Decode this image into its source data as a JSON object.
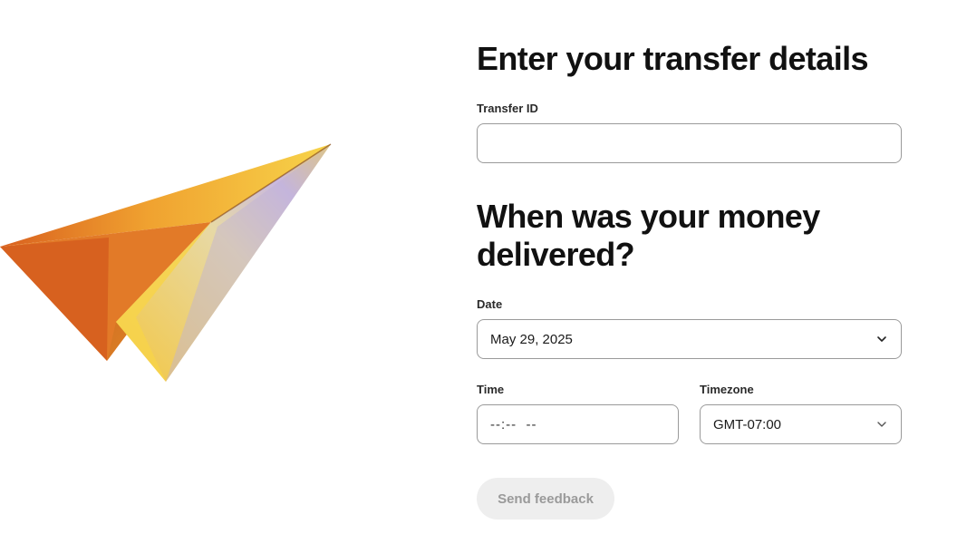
{
  "form": {
    "title": "Enter your transfer details",
    "transfer_id_label": "Transfer ID",
    "transfer_id_value": "",
    "delivery_heading": "When was your money delivered?",
    "date_label": "Date",
    "date_value": "May 29, 2025",
    "time_label": "Time",
    "time_value": "--:--  --",
    "timezone_label": "Timezone",
    "timezone_value": "GMT-07:00",
    "submit_label": "Send feedback"
  },
  "icons": {
    "hero": "paper-plane-illustration",
    "date_dropdown": "chevron-down-icon",
    "timezone_dropdown": "chevron-down-icon"
  },
  "colors": {
    "button_disabled_bg": "#eeeeee",
    "button_disabled_text": "#9a9a9a",
    "input_border": "#9a9a9a"
  }
}
